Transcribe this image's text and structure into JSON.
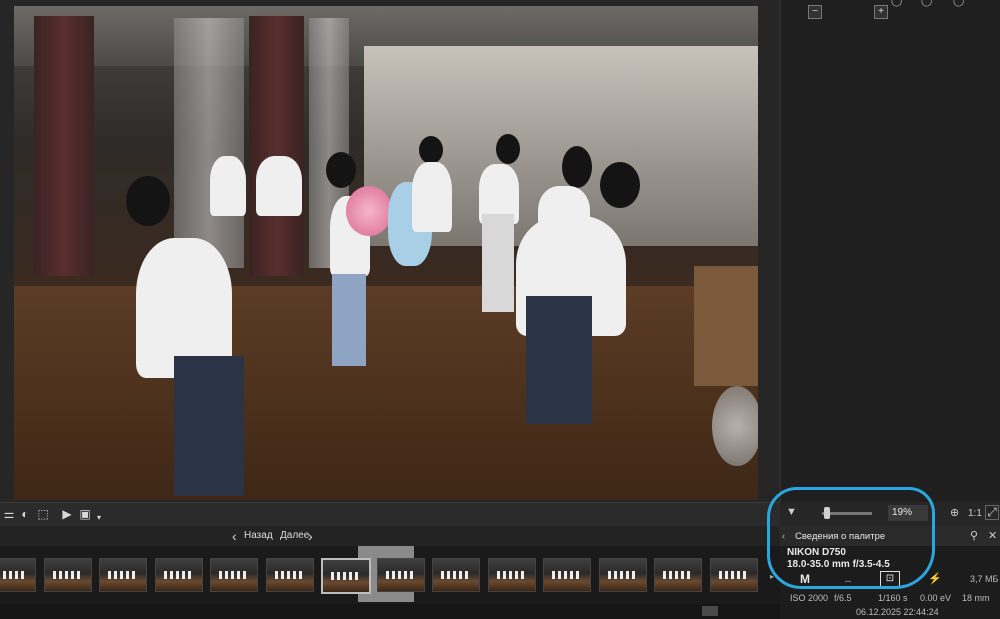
{
  "filmstrip": {
    "back_label": "Назад",
    "next_label": "Далее",
    "thumbnail_count": 14,
    "selected_index": 6
  },
  "zoom": {
    "value": "19%",
    "one_to_one": "1:1"
  },
  "info_palette": {
    "title": "Сведения о палитре",
    "camera": "NIKON D750",
    "lens": "18.0-35.0 mm f/3.5-4.5",
    "mode": "M",
    "dash1": "--",
    "file_size": "3,7 МБ",
    "dash2": "--",
    "iso": "ISO 2000",
    "shutter": "1/160 s",
    "ev": "0.00 eV",
    "focal_length": "18 mm",
    "datetime": "06.12.2025 22:44:24",
    "aperture_partial": "f/6.5"
  },
  "colors": {
    "annotation": "#2aa7e0"
  }
}
